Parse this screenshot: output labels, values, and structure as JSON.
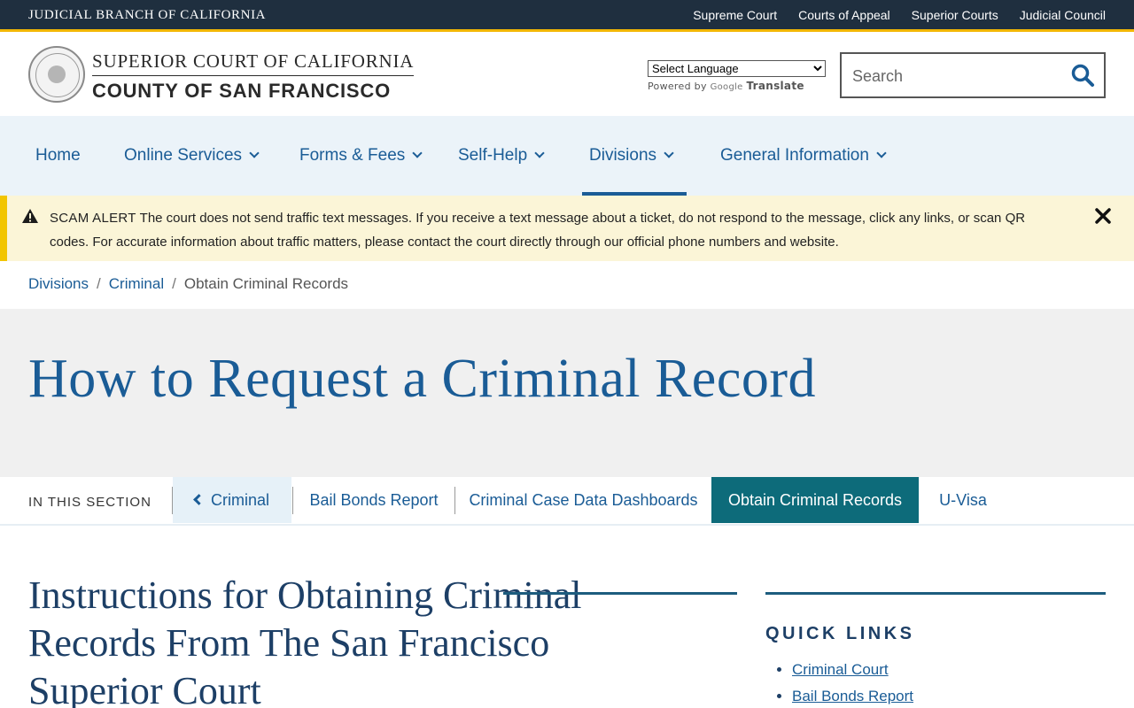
{
  "topbar": {
    "brand": "JUDICIAL BRANCH OF CALIFORNIA",
    "links": [
      "Supreme Court",
      "Courts of Appeal",
      "Superior Courts",
      "Judicial Council"
    ],
    "bg_color": "#1f2f3f",
    "accent_color": "#f2b705"
  },
  "header": {
    "line1": "SUPERIOR COURT OF CALIFORNIA",
    "line2": "COUNTY OF SAN FRANCISCO",
    "translate": {
      "select_value": "Select Language",
      "powered_by": "Powered by",
      "google": "Google",
      "translate": "Translate"
    },
    "search": {
      "placeholder": "Search",
      "icon": "search-icon"
    }
  },
  "nav": {
    "items": [
      {
        "label": "Home"
      },
      {
        "label": "Online Services"
      },
      {
        "label": "Forms & Fees"
      },
      {
        "label": "Self-Help"
      },
      {
        "label": "Divisions"
      },
      {
        "label": "General Information"
      }
    ],
    "active": "Divisions",
    "color": "#1a5c96"
  },
  "alert": {
    "title": "SCAM ALERT",
    "message": "The court does not send traffic text messages.  If you receive a text message about a ticket, do not respond to the message, click any links, or scan QR codes.  For accurate information about traffic matters, please contact the court directly through our official phone numbers and website.",
    "icons": [
      "warning-icon",
      "close-icon"
    ],
    "bg_color": "#fbf5d7",
    "accent_color": "#f2c500"
  },
  "breadcrumb": {
    "items": [
      "Divisions",
      "Criminal",
      "Obtain Criminal Records"
    ],
    "separator": "/"
  },
  "hero": {
    "title": "How to Request a Criminal Record"
  },
  "section_nav": {
    "label": "IN THIS SECTION",
    "back": "Criminal",
    "tabs": [
      "Bail Bonds Report",
      "Criminal Case Data Dashboards",
      "Obtain Criminal Records",
      "U-Visa"
    ],
    "active": "Obtain Criminal Records",
    "active_color": "#0d6b7a"
  },
  "content": {
    "heading": "Instructions for Obtaining Criminal Records From The San Francisco Superior Court"
  },
  "quick_links": {
    "title": "QUICK LINKS",
    "items": [
      "Criminal Court",
      "Bail Bonds Report"
    ]
  }
}
